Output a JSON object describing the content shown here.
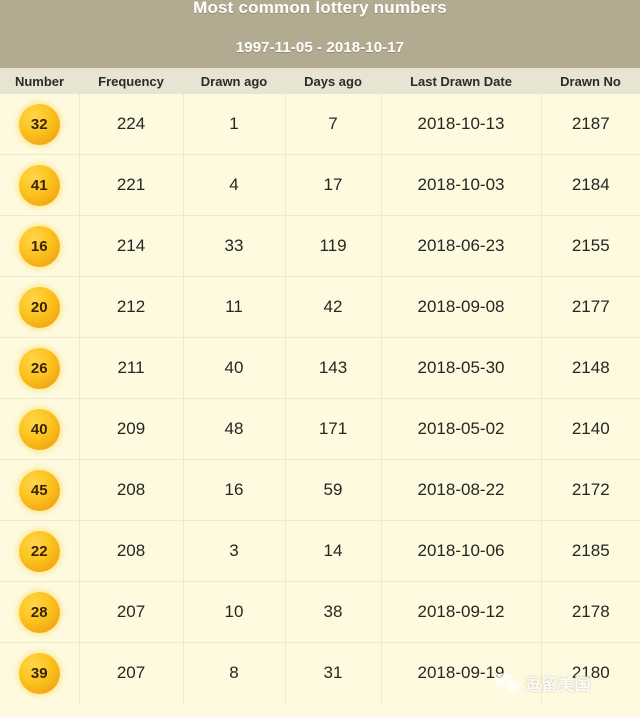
{
  "header": {
    "title": "Most common lottery numbers",
    "date_range": "1997-11-05 - 2018-10-17"
  },
  "table": {
    "columns": [
      "Number",
      "Frequency",
      "Drawn ago",
      "Days ago",
      "Last Drawn Date",
      "Drawn No"
    ],
    "rows": [
      {
        "number": "32",
        "frequency": "224",
        "drawn_ago": "1",
        "days_ago": "7",
        "last_drawn_date": "2018-10-13",
        "drawn_no": "2187"
      },
      {
        "number": "41",
        "frequency": "221",
        "drawn_ago": "4",
        "days_ago": "17",
        "last_drawn_date": "2018-10-03",
        "drawn_no": "2184"
      },
      {
        "number": "16",
        "frequency": "214",
        "drawn_ago": "33",
        "days_ago": "119",
        "last_drawn_date": "2018-06-23",
        "drawn_no": "2155"
      },
      {
        "number": "20",
        "frequency": "212",
        "drawn_ago": "11",
        "days_ago": "42",
        "last_drawn_date": "2018-09-08",
        "drawn_no": "2177"
      },
      {
        "number": "26",
        "frequency": "211",
        "drawn_ago": "40",
        "days_ago": "143",
        "last_drawn_date": "2018-05-30",
        "drawn_no": "2148"
      },
      {
        "number": "40",
        "frequency": "209",
        "drawn_ago": "48",
        "days_ago": "171",
        "last_drawn_date": "2018-05-02",
        "drawn_no": "2140"
      },
      {
        "number": "45",
        "frequency": "208",
        "drawn_ago": "16",
        "days_ago": "59",
        "last_drawn_date": "2018-08-22",
        "drawn_no": "2172"
      },
      {
        "number": "22",
        "frequency": "208",
        "drawn_ago": "3",
        "days_ago": "14",
        "last_drawn_date": "2018-10-06",
        "drawn_no": "2185"
      },
      {
        "number": "28",
        "frequency": "207",
        "drawn_ago": "10",
        "days_ago": "38",
        "last_drawn_date": "2018-09-12",
        "drawn_no": "2178"
      },
      {
        "number": "39",
        "frequency": "207",
        "drawn_ago": "8",
        "days_ago": "31",
        "last_drawn_date": "2018-09-19",
        "drawn_no": "2180"
      }
    ]
  },
  "watermark": {
    "icon": "wechat-icon",
    "text": "逗留美国"
  },
  "colors": {
    "title_band": "#b3ab91",
    "header_row": "#e8e4d4",
    "cell_background": "#fdfae0",
    "grid_line": "#efe9c9",
    "ball_gold": "#fcc41f",
    "text_dark": "#262622"
  }
}
